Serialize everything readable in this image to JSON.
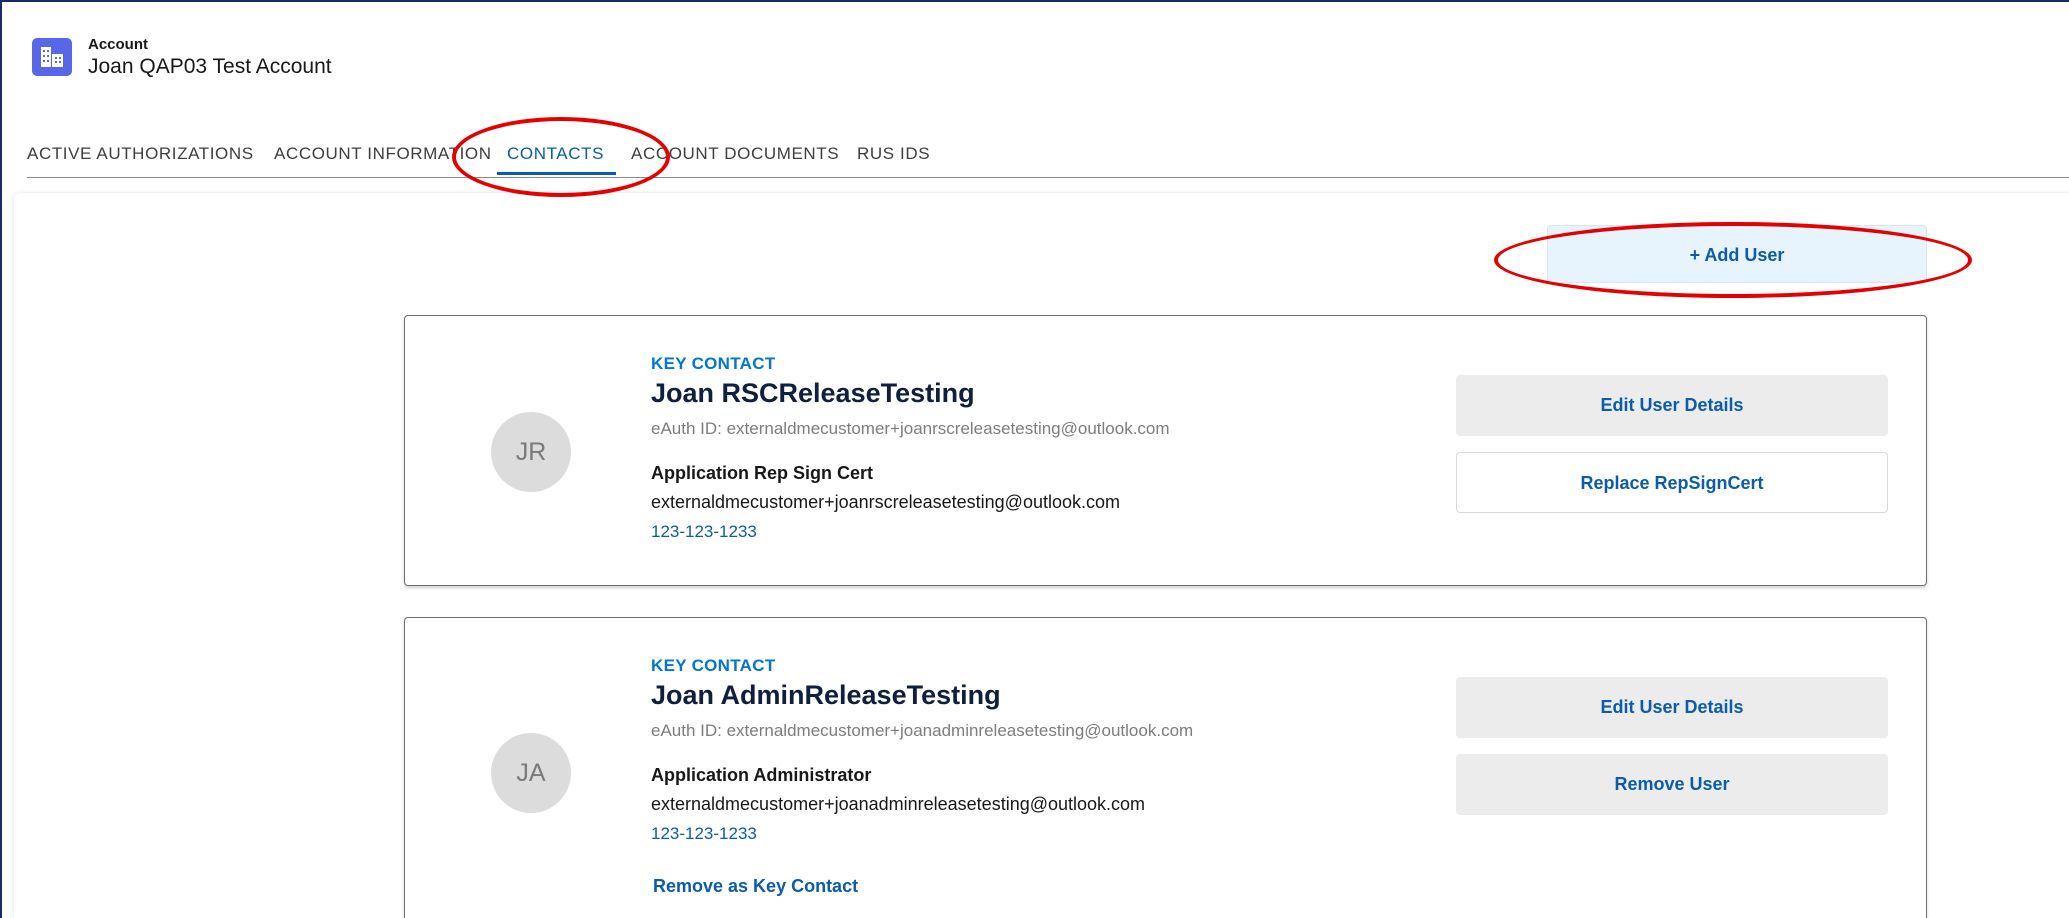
{
  "header": {
    "object_label": "Account",
    "record_title": "Joan QAP03 Test Account",
    "icon": "building-icon"
  },
  "tabs": [
    {
      "label": "ACTIVE AUTHORIZATIONS",
      "active": false
    },
    {
      "label": "ACCOUNT INFORMATION",
      "active": false
    },
    {
      "label": "CONTACTS",
      "active": true
    },
    {
      "label": "ACCOUNT DOCUMENTS",
      "active": false
    },
    {
      "label": "RUS IDS",
      "active": false
    }
  ],
  "add_user_label": "+ Add User",
  "contacts": [
    {
      "initials": "JR",
      "badge": "KEY CONTACT",
      "name": "Joan  RSCReleaseTesting",
      "eauth": "eAuth ID: externaldmecustomer+joanrscreleasetesting@outlook.com",
      "role": "Application Rep Sign Cert",
      "email": "externaldmecustomer+joanrscreleasetesting@outlook.com",
      "phone": "123-123-1233",
      "primary_action": "Edit User Details",
      "secondary_action": "Replace RepSignCert"
    },
    {
      "initials": "JA",
      "badge": "KEY CONTACT",
      "name": "Joan  AdminReleaseTesting",
      "eauth": "eAuth ID: externaldmecustomer+joanadminreleasetesting@outlook.com",
      "role": "Application Administrator",
      "email": "externaldmecustomer+joanadminreleasetesting@outlook.com",
      "phone": "123-123-1233",
      "primary_action": "Edit User Details",
      "secondary_action": "Remove User",
      "remove_key_contact": "Remove as Key Contact"
    }
  ],
  "colors": {
    "accent": "#0b5cab",
    "icon_bg": "#5867e8",
    "annotation": "#e60000"
  }
}
